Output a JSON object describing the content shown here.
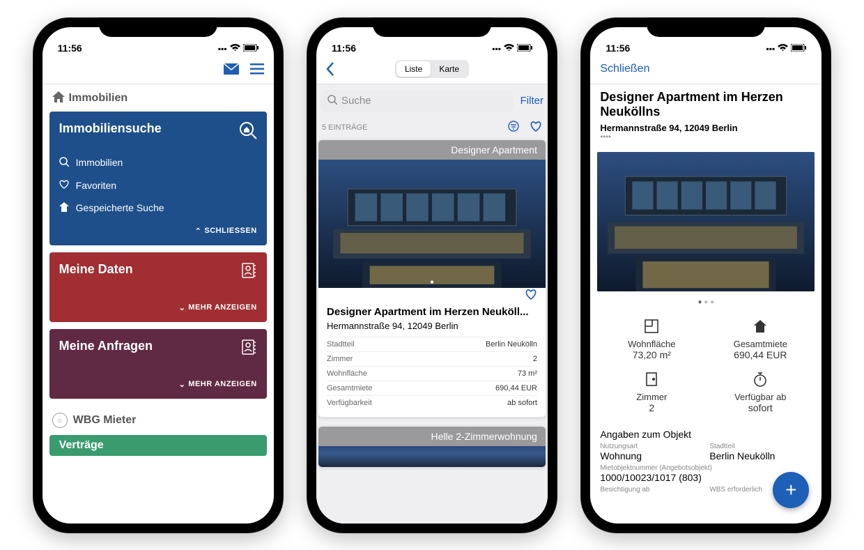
{
  "status": {
    "time": "11:56"
  },
  "screen1": {
    "section": "Immobilien",
    "card_blue": {
      "title": "Immobiliensuche",
      "items": [
        "Immobilien",
        "Favoriten",
        "Gespeicherte Suche"
      ],
      "footer": "SCHLIESSEN"
    },
    "card_red": {
      "title": "Meine Daten",
      "footer": "MEHR ANZEIGEN"
    },
    "card_purple": {
      "title": "Meine Anfragen",
      "footer": "MEHR ANZEIGEN"
    },
    "wbg": "WBG Mieter",
    "card_green": {
      "title": "Verträge"
    }
  },
  "screen2": {
    "tabs": {
      "list": "Liste",
      "map": "Karte"
    },
    "search_placeholder": "Suche",
    "filter": "Filter",
    "count_label": "5 EINTRÄGE",
    "listing": {
      "badge": "Designer Apartment",
      "title": "Designer Apartment im Herzen Neuköll...",
      "address": "Hermannstraße 94, 12049 Berlin",
      "rows": [
        {
          "k": "Stadtteil",
          "v": "Berlin Neukölln"
        },
        {
          "k": "Zimmer",
          "v": "2"
        },
        {
          "k": "Wohnfläche",
          "v": "73 m²"
        },
        {
          "k": "Gesamtmiete",
          "v": "690,44  EUR"
        },
        {
          "k": "Verfügbarkeit",
          "v": "ab sofort"
        }
      ]
    },
    "listing2_badge": "Helle 2-Zimmerwohnung"
  },
  "screen3": {
    "close": "Schließen",
    "title": "Designer Apartment im Herzen Neuköllns",
    "address": "Hermannstraße 94, 12049 Berlin",
    "stars": "****",
    "facts": {
      "area": {
        "label": "Wohnfläche",
        "value": "73,20 m²"
      },
      "rent": {
        "label": "Gesamtmiete",
        "value": "690,44 EUR"
      },
      "rooms": {
        "label": "Zimmer",
        "value": "2"
      },
      "avail": {
        "label": "Verfügbar ab",
        "value": "sofort"
      }
    },
    "obj_header": "Angaben zum Objekt",
    "obj": {
      "usage": {
        "label": "Nutzungsart",
        "value": "Wohnung"
      },
      "district": {
        "label": "Stadtteil",
        "value": "Berlin Neukölln"
      },
      "number": {
        "label": "Mietobjektnummer (Angebotsobjekt)",
        "value": "1000/10023/1017 (803)"
      },
      "visit": {
        "label": "Besichtigung ab"
      },
      "wbs": {
        "label": "WBS erforderlich"
      }
    }
  }
}
